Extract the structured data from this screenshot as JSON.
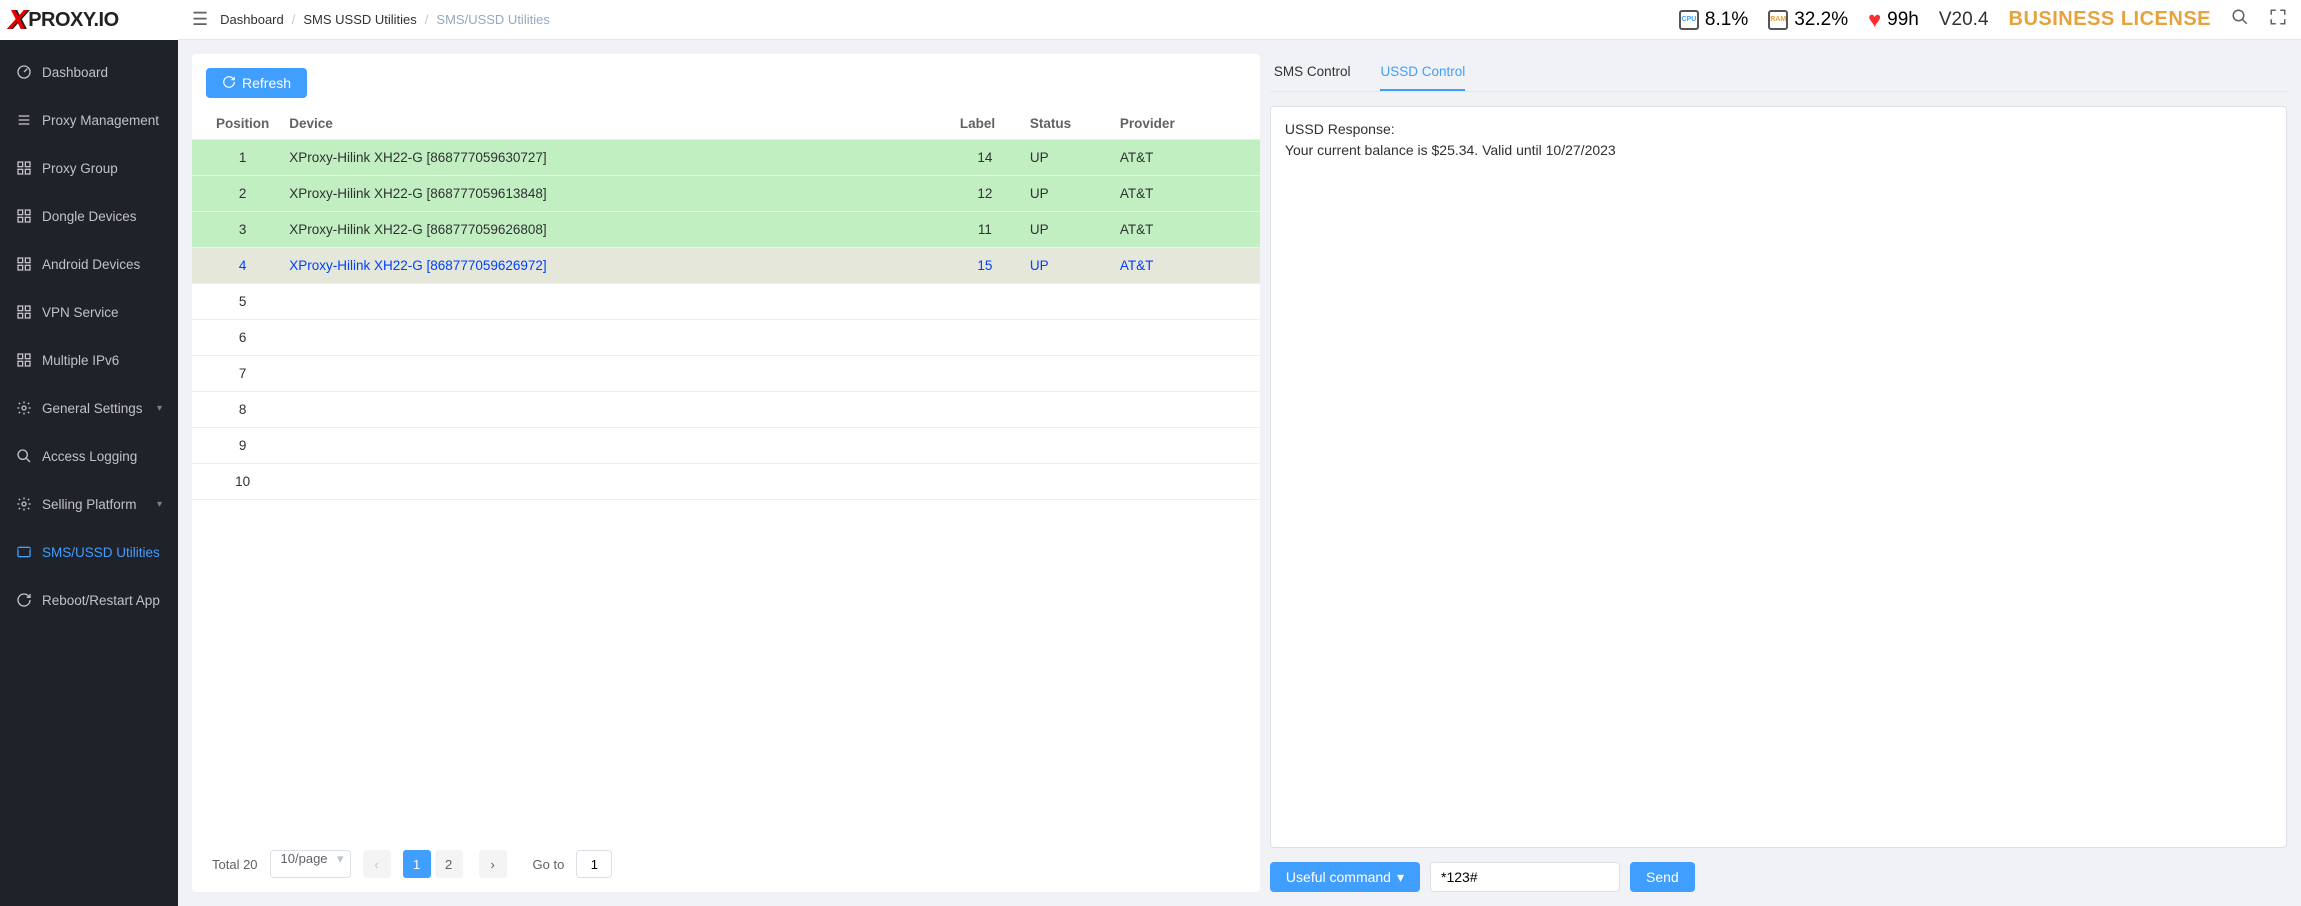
{
  "logo_text": "PROXY.IO",
  "breadcrumb": {
    "root": "Dashboard",
    "mid": "SMS USSD Utilities",
    "cur": "SMS/USSD Utilities"
  },
  "header": {
    "cpu": "8.1%",
    "ram": "32.2%",
    "health": "99h",
    "version": "V20.4",
    "license": "BUSINESS LICENSE"
  },
  "sidebar": {
    "items": [
      {
        "label": "Dashboard",
        "icon": "dashboard"
      },
      {
        "label": "Proxy Management",
        "icon": "list"
      },
      {
        "label": "Proxy Group",
        "icon": "grid"
      },
      {
        "label": "Dongle Devices",
        "icon": "grid"
      },
      {
        "label": "Android Devices",
        "icon": "grid"
      },
      {
        "label": "VPN Service",
        "icon": "grid"
      },
      {
        "label": "Multiple IPv6",
        "icon": "grid"
      },
      {
        "label": "General Settings",
        "icon": "gear",
        "expandable": true
      },
      {
        "label": "Access Logging",
        "icon": "search"
      },
      {
        "label": "Selling Platform",
        "icon": "gear",
        "expandable": true
      },
      {
        "label": "SMS/USSD Utilities",
        "icon": "mail",
        "active": true
      },
      {
        "label": "Reboot/Restart App",
        "icon": "cycle"
      }
    ]
  },
  "toolbar": {
    "refresh_label": "Refresh"
  },
  "table": {
    "headers": {
      "position": "Position",
      "device": "Device",
      "label": "Label",
      "status": "Status",
      "provider": "Provider"
    },
    "rows": [
      {
        "position": "1",
        "device": "XProxy-Hilink XH22-G [868777059630727]",
        "label": "14",
        "status": "UP",
        "provider": "AT&T",
        "filled": true
      },
      {
        "position": "2",
        "device": "XProxy-Hilink XH22-G [868777059613848]",
        "label": "12",
        "status": "UP",
        "provider": "AT&T",
        "filled": true
      },
      {
        "position": "3",
        "device": "XProxy-Hilink XH22-G [868777059626808]",
        "label": "11",
        "status": "UP",
        "provider": "AT&T",
        "filled": true
      },
      {
        "position": "4",
        "device": "XProxy-Hilink XH22-G [868777059626972]",
        "label": "15",
        "status": "UP",
        "provider": "AT&T",
        "filled": true,
        "selected": true
      },
      {
        "position": "5"
      },
      {
        "position": "6"
      },
      {
        "position": "7"
      },
      {
        "position": "8"
      },
      {
        "position": "9"
      },
      {
        "position": "10"
      }
    ]
  },
  "pagination": {
    "total_label": "Total 20",
    "per_page": "10/page",
    "pages": [
      "1",
      "2"
    ],
    "current": "1",
    "goto_label": "Go to",
    "goto_value": "1"
  },
  "tabs": {
    "sms": "SMS Control",
    "ussd": "USSD Control"
  },
  "ussd": {
    "response": "USSD Response:\nYour current balance is $25.34. Valid until 10/27/2023",
    "useful_cmd_label": "Useful command",
    "input_value": "*123#",
    "send_label": "Send"
  }
}
